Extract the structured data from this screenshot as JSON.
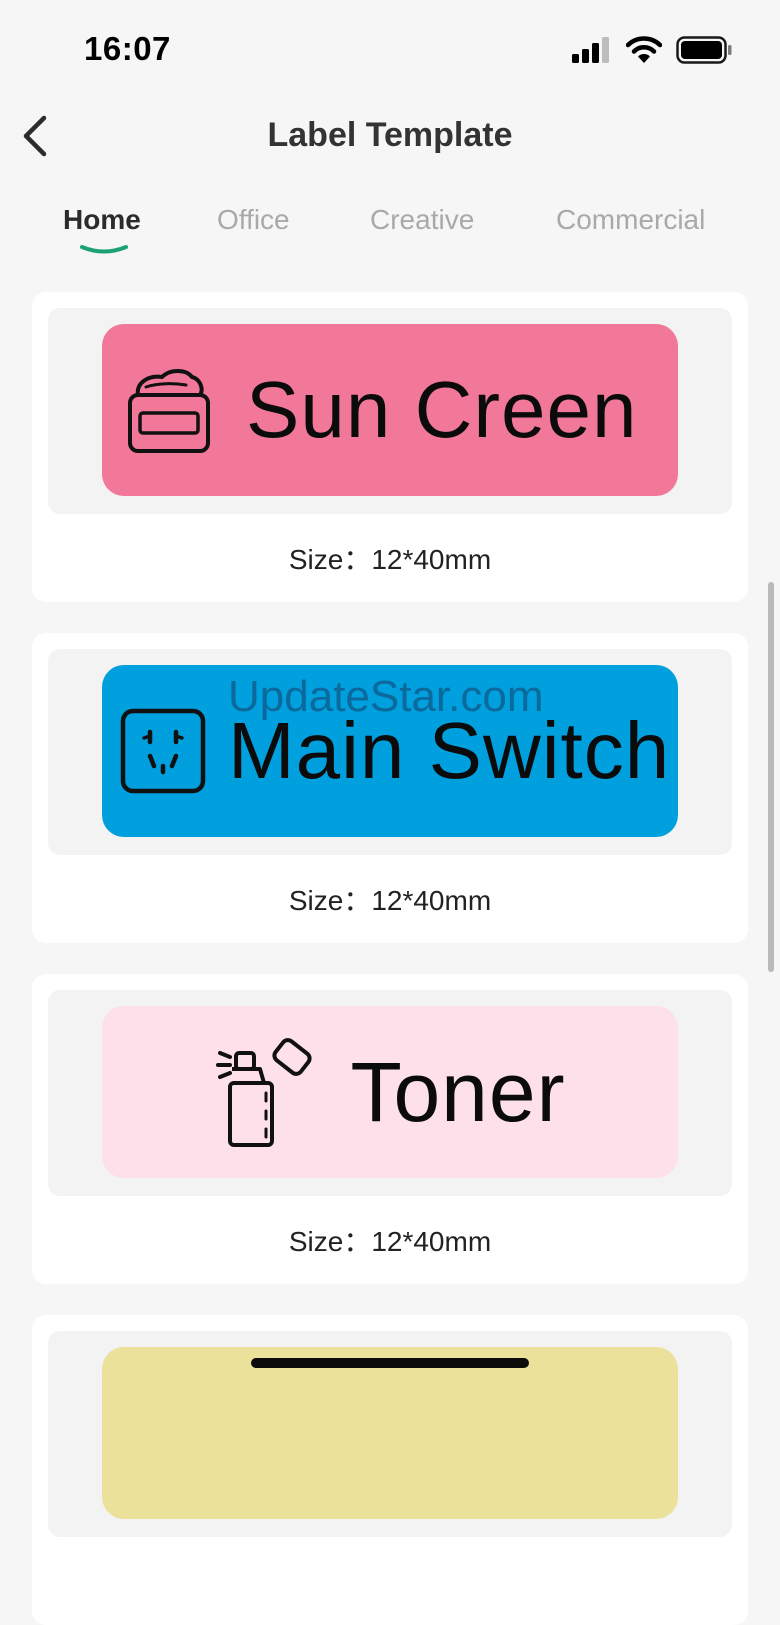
{
  "status_bar": {
    "time": "16:07"
  },
  "header": {
    "title": "Label Template"
  },
  "tabs": [
    {
      "label": "Home",
      "active": true
    },
    {
      "label": "Office",
      "active": false
    },
    {
      "label": "Creative",
      "active": false
    },
    {
      "label": "Commercial",
      "active": false
    }
  ],
  "templates": [
    {
      "label": "Sun Creen",
      "icon": "cream-jar-icon",
      "color": "#f27899",
      "size": "Size：12*40mm"
    },
    {
      "label": "Main Switch",
      "icon": "power-socket-icon",
      "color": "#009fde",
      "size": "Size：12*40mm"
    },
    {
      "label": "Toner",
      "icon": "spray-bottle-icon",
      "color": "#fde0ea",
      "size": "Size：12*40mm"
    },
    {
      "label": "",
      "icon": "",
      "color": "#ebe19a",
      "size": ""
    }
  ],
  "watermark": "UpdateStar.com",
  "colors": {
    "accent": "#1aa272",
    "background": "#f6f6f6"
  }
}
